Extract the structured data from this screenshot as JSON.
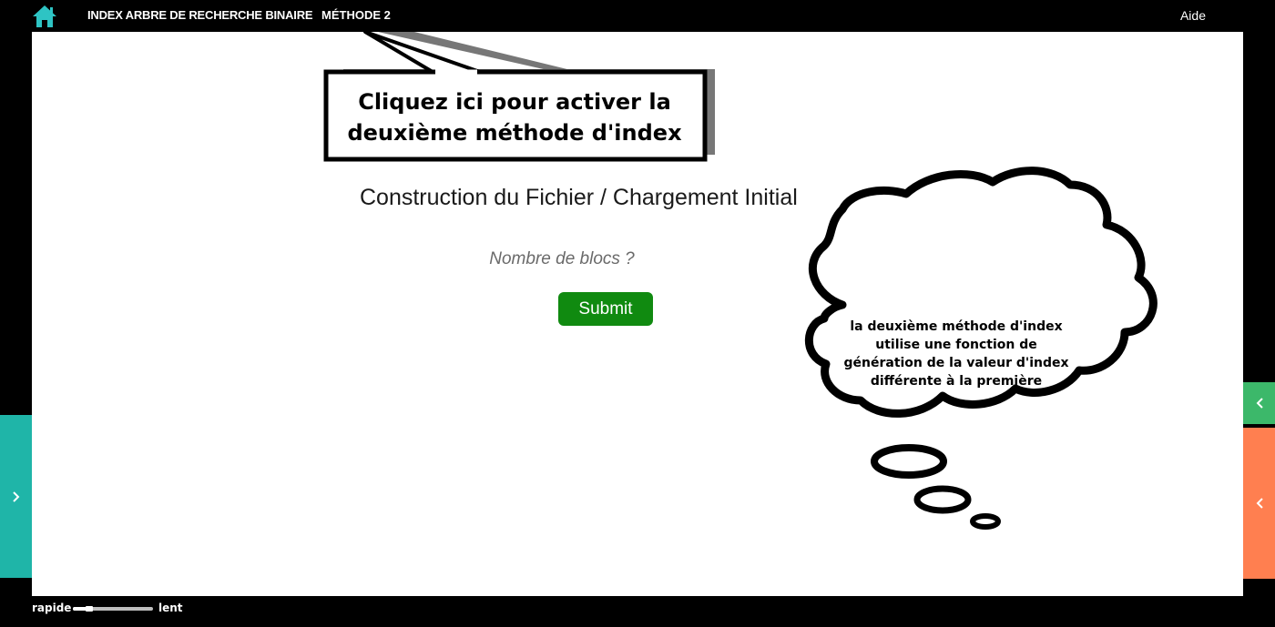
{
  "header": {
    "home_icon": "home-icon",
    "title": "INDEX ARBRE DE RECHERCHE BINAIRE",
    "method_label": "MÉTHODE 2",
    "help_label": "Aide"
  },
  "main": {
    "heading": "Construction du Fichier / Chargement Initial",
    "blocks_input": {
      "placeholder": "Nombre de blocs ?",
      "value": ""
    },
    "submit_label": "Submit"
  },
  "annotations": {
    "callout_line1": "Cliquez ici pour activer la",
    "callout_line2": "deuxième méthode d'index",
    "cloud_lines": [
      "la deuxième méthode d'index",
      "utilise une fonction de",
      "génération de la valeur d'index",
      "différente à la première"
    ]
  },
  "navigation": {
    "left_icon": "chevron-right-icon",
    "right_icon": "chevron-left-icon",
    "left_color": "#1fb5a8",
    "right_top_color": "#3cb86a",
    "right_bottom_color": "#ff7f50"
  },
  "speed": {
    "fast_label": "rapide",
    "slow_label": "lent",
    "level": 0.2
  },
  "colors": {
    "home_icon": "#2ec4c4",
    "submit": "#108a10",
    "background": "#000000",
    "panel": "#ffffff"
  }
}
